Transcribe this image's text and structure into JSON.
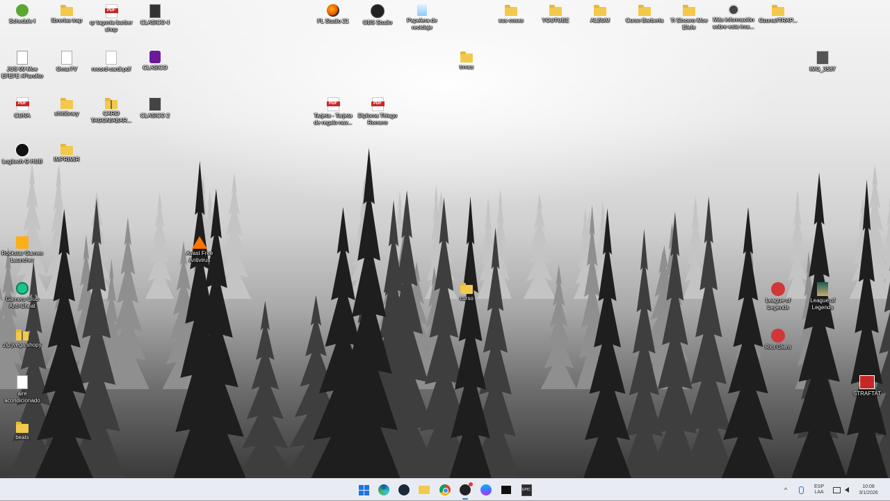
{
  "desktop": {
    "wallpaper": "misty-pine-forest-grayscale",
    "icons": [
      {
        "id": "schedule",
        "label": "Schedule I",
        "icon": "schedule-app-icon"
      },
      {
        "id": "librerias-trap",
        "label": "librerias trap",
        "icon": "folder-icon"
      },
      {
        "id": "qr-tagonia",
        "label": "qr tagonia barber shop",
        "icon": "pdf-icon"
      },
      {
        "id": "clasico-4",
        "label": "CLASICO 4",
        "icon": "media-file-icon"
      },
      {
        "id": "fl-studio",
        "label": "FL Studio 21",
        "icon": "fl-studio-icon"
      },
      {
        "id": "obs-studio",
        "label": "OBS Studio",
        "icon": "obs-icon"
      },
      {
        "id": "papelera",
        "label": "Papelera de reciclaje",
        "icon": "recycle-bin-icon"
      },
      {
        "id": "sus-cosas",
        "label": "sus cosas",
        "icon": "folder-icon"
      },
      {
        "id": "youtube",
        "label": "YOUTUBE",
        "icon": "folder-icon"
      },
      {
        "id": "album",
        "label": "ALBUM",
        "icon": "folder-icon"
      },
      {
        "id": "curso-barberia",
        "label": "Curso Barberia",
        "icon": "folder-icon"
      },
      {
        "id": "ti-sincero",
        "label": "Ti Sincero Moe Efefe",
        "icon": "folder-icon"
      },
      {
        "id": "mas-info",
        "label": "Más información sobre esta ima...",
        "icon": "info-icon"
      },
      {
        "id": "ozuna",
        "label": "Ozuna//TRAP...",
        "icon": "folder-icon"
      },
      {
        "id": "moe-efefe",
        "label": "JUS 09 Moe EFEFE #Parolito",
        "icon": "audio-file-icon"
      },
      {
        "id": "omar",
        "label": "Omar7V",
        "icon": "app-icon"
      },
      {
        "id": "record-cardi",
        "label": "record-cardi.pdf",
        "icon": "document-icon"
      },
      {
        "id": "clasico",
        "label": "CLASICO",
        "icon": "media-file-icon"
      },
      {
        "id": "trmas",
        "label": "trmas",
        "icon": "folder-icon"
      },
      {
        "id": "img-3587",
        "label": "IMG_3587",
        "icon": "image-file-icon"
      },
      {
        "id": "cuna",
        "label": "CUNA",
        "icon": "pdf-icon"
      },
      {
        "id": "shittibrary",
        "label": "shittibrary",
        "icon": "folder-icon"
      },
      {
        "id": "caro",
        "label": "CARO TAGONIABAR...",
        "icon": "zip-folder-icon"
      },
      {
        "id": "clasico-2",
        "label": "CLASICO 2",
        "icon": "media-file-icon"
      },
      {
        "id": "tarjeta",
        "label": "Tarjeta - Tarjeta de regalo nav...",
        "icon": "pdf-icon"
      },
      {
        "id": "diploma",
        "label": "Diploma Thiago Romero",
        "icon": "pdf-icon"
      },
      {
        "id": "logitech",
        "label": "Logitech G HUB",
        "icon": "logitech-ghub-icon"
      },
      {
        "id": "imprimir",
        "label": "IMPRIMIR",
        "icon": "folder-icon"
      },
      {
        "id": "rockstar",
        "label": "Rockstar Games Launcher",
        "icon": "rockstar-icon"
      },
      {
        "id": "avast",
        "label": "Avast Free Antivirus",
        "icon": "avast-icon"
      },
      {
        "id": "gamers-club",
        "label": "Gamers Club Anti-Cheat",
        "icon": "gamers-club-icon"
      },
      {
        "id": "curso",
        "label": "curso",
        "icon": "folder-icon"
      },
      {
        "id": "lol-1",
        "label": "League of Legends",
        "icon": "riot-icon"
      },
      {
        "id": "lol-2",
        "label": "League of Legends",
        "icon": "league-of-legends-icon"
      },
      {
        "id": "zip-jvega",
        "label": "zip jvega shopy",
        "icon": "zip-folder-icon"
      },
      {
        "id": "riot-client",
        "label": "Riot Client",
        "icon": "riot-icon"
      },
      {
        "id": "aire",
        "label": "aire acondicionado",
        "icon": "image-file-icon"
      },
      {
        "id": "strafat",
        "label": "STRAFTAT",
        "icon": "strafat-icon"
      },
      {
        "id": "beats",
        "label": "beats",
        "icon": "folder-icon"
      }
    ]
  },
  "taskbar": {
    "apps": [
      {
        "id": "start",
        "icon": "windows-start-icon",
        "active": false
      },
      {
        "id": "edge",
        "icon": "edge-icon",
        "active": false
      },
      {
        "id": "steam",
        "icon": "steam-icon",
        "active": false
      },
      {
        "id": "explorer",
        "icon": "file-explorer-icon",
        "active": false
      },
      {
        "id": "chrome",
        "icon": "chrome-icon",
        "active": false
      },
      {
        "id": "obs",
        "icon": "obs-icon",
        "active": true
      },
      {
        "id": "messenger",
        "icon": "messenger-icon",
        "active": false
      },
      {
        "id": "capcut",
        "icon": "capcut-icon",
        "active": false
      },
      {
        "id": "epic",
        "icon": "epic-games-icon",
        "active": false
      }
    ],
    "tray": {
      "lang_top": "ESP",
      "lang_bottom": "LAA",
      "time": "10:08",
      "date": "3/1/2026"
    }
  }
}
